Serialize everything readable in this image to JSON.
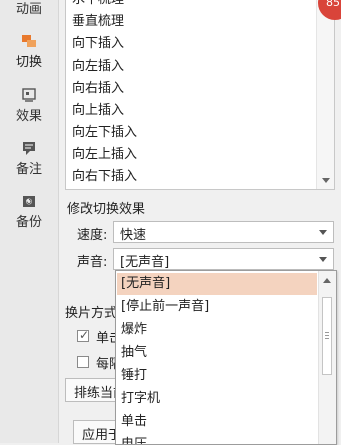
{
  "nav": {
    "animation_label": "动画",
    "switch_label": "切换",
    "effect_label": "效果",
    "notes_label": "备注",
    "backup_label": "备份"
  },
  "transitions": {
    "items": [
      "水平梳理",
      "垂直梳理",
      "向下插入",
      "向左插入",
      "向右插入",
      "向上插入",
      "向左下插入",
      "向左上插入",
      "向右下插入"
    ]
  },
  "modify": {
    "title": "修改切换效果",
    "speed_label": "速度:",
    "speed_value": "快速",
    "sound_label": "声音:",
    "sound_value": "[无声音]"
  },
  "slide_switch": {
    "title": "换片方式",
    "single_click": "单击鼠标时",
    "every": "每隔"
  },
  "rehearse_button": "排练当前页",
  "apply_button": "应用于所有幻灯片",
  "sound_dropdown": {
    "options": [
      "[无声音]",
      "[停止前一声音]",
      "爆炸",
      "抽气",
      "锤打",
      "打字机",
      "单击",
      "电压"
    ],
    "selected_index": 0
  },
  "badge": "85"
}
